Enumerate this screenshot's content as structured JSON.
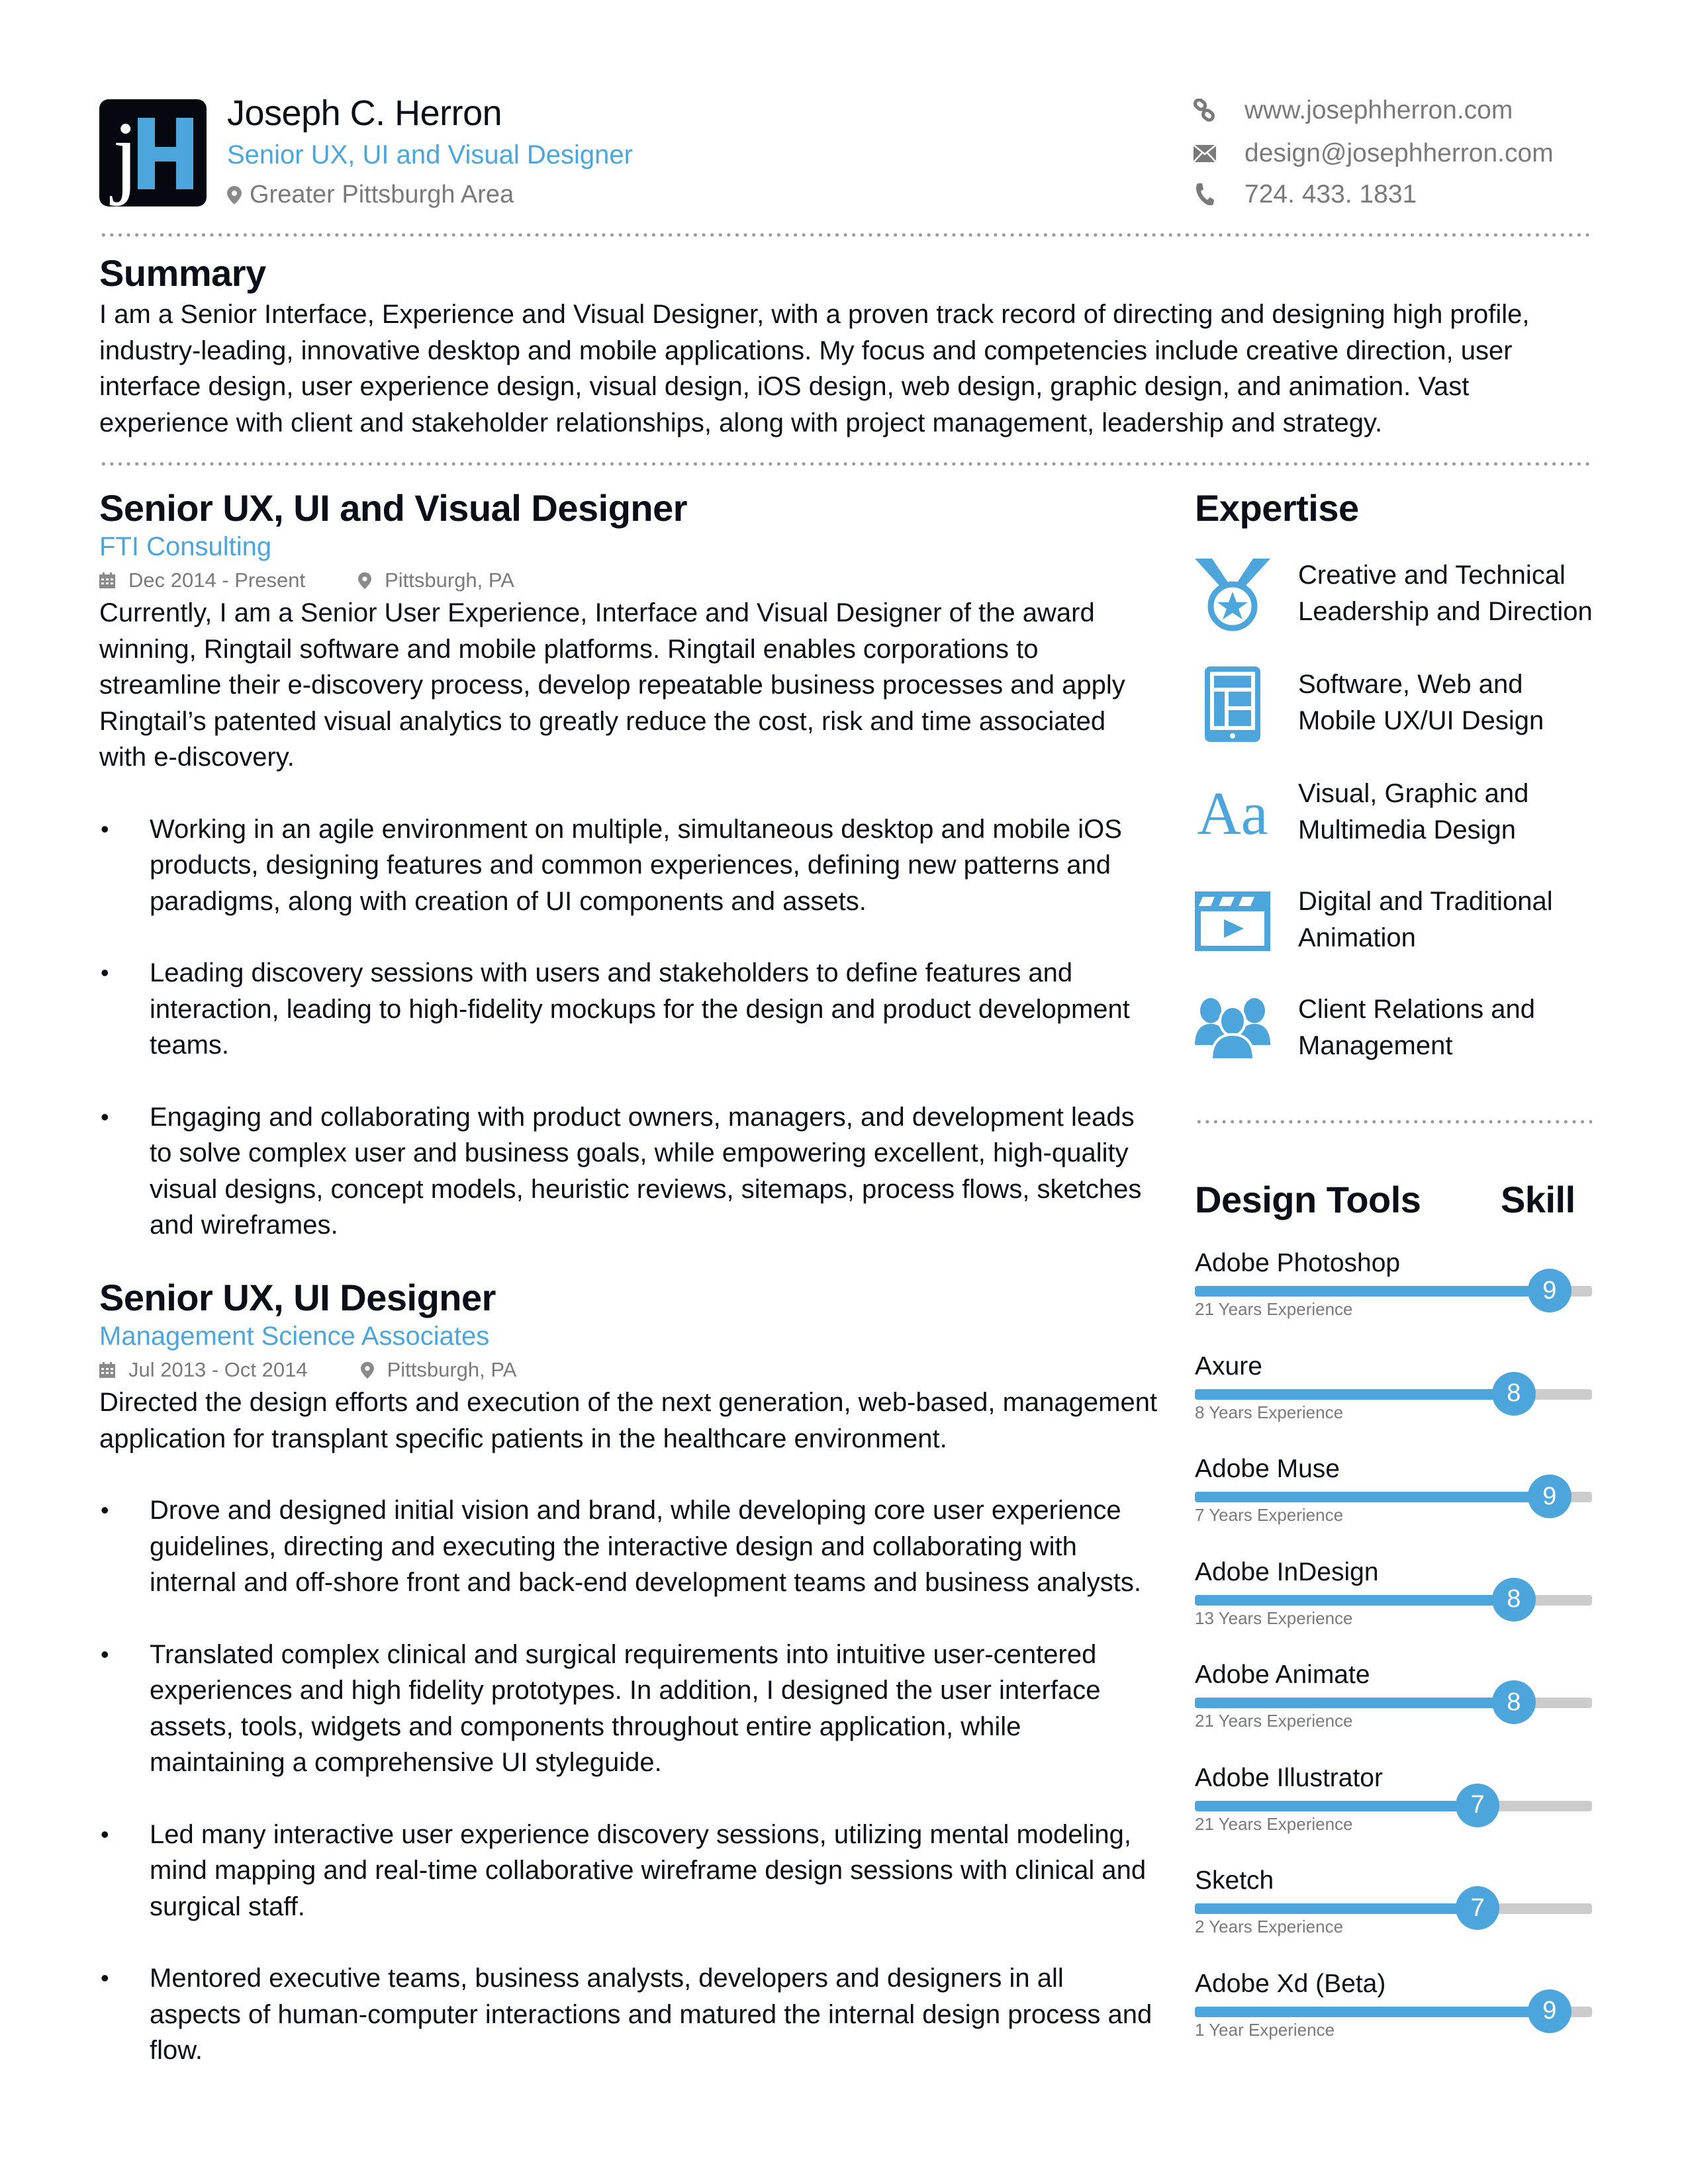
{
  "header": {
    "logo_letters": [
      "j",
      "H"
    ],
    "name": "Joseph C. Herron",
    "title": "Senior UX, UI and Visual Designer",
    "location": "Greater Pittsburgh Area",
    "contacts": [
      {
        "icon": "link-icon",
        "text": "www.josephherron.com"
      },
      {
        "icon": "envelope-icon",
        "text": "design@josephherron.com"
      },
      {
        "icon": "phone-icon",
        "text": "724. 433. 1831"
      }
    ]
  },
  "summary": {
    "heading": "Summary",
    "text": "I am a Senior Interface, Experience and Visual Designer, with a proven track record of directing and designing high profile, industry-leading, innovative desktop and mobile applications.  My focus and competencies include creative direction, user interface design, user experience design, visual design, iOS design, web design, graphic design, and animation.  Vast experience with client and stakeholder relationships, along with project management, leadership and strategy."
  },
  "jobs": [
    {
      "title": "Senior UX, UI and Visual Designer",
      "company": "FTI Consulting",
      "dates": "Dec 2014 - Present",
      "location": "Pittsburgh, PA",
      "description": "Currently, I am a Senior User Experience, Interface and Visual Designer of the award winning, Ringtail software and mobile platforms. Ringtail enables corporations to streamline their e-discovery process, develop repeatable business processes and apply Ringtail’s patented visual analytics to greatly reduce the cost, risk and time associated with e-discovery.",
      "bullets": [
        "Working in an agile environment on multiple, simultaneous desktop and mobile iOS products, designing features and common experiences, defining new patterns and paradigms, along with creation of UI components and assets.",
        "Leading discovery sessions with users and stakeholders to define features and interaction, leading to high-fidelity mockups for the design and product development teams.",
        "Engaging and collaborating with product owners, managers, and development leads to solve complex user and business goals, while empowering excellent, high-quality visual designs, concept models, heuristic reviews, sitemaps, process flows, sketches and wireframes."
      ]
    },
    {
      "title": "Senior UX, UI Designer",
      "company": "Management Science Associates",
      "dates": "Jul 2013 - Oct 2014",
      "location": "Pittsburgh, PA",
      "description": "Directed the design efforts and execution of the next generation, web-based, management application for transplant specific patients in the healthcare environment.",
      "bullets": [
        "Drove and designed initial vision and brand, while developing core user experience guidelines, directing and executing the interactive design and collaborating with internal and off-shore front and back-end development teams and business analysts.",
        "Translated complex clinical and surgical requirements into intuitive user-centered experiences and high fidelity prototypes. In addition, I designed the user interface assets, tools, widgets and components throughout entire application, while maintaining a comprehensive UI styleguide.",
        "Led many interactive user experience discovery sessions, utilizing mental modeling, mind mapping and real-time collaborative wireframe design sessions with clinical and surgical staff.",
        "Mentored executive teams, business analysts, developers and designers in all aspects of human-computer interactions and matured the internal design process and flow."
      ]
    }
  ],
  "expertise": {
    "heading": "Expertise",
    "items": [
      {
        "icon": "medal-icon",
        "label": "Creative and Technical Leadership and Direction"
      },
      {
        "icon": "tablet-icon",
        "label": "Software, Web and Mobile UX/UI Design"
      },
      {
        "icon": "typography-icon",
        "label": "Visual, Graphic and Multimedia Design",
        "glyph": "Aa"
      },
      {
        "icon": "video-clapper-icon",
        "label": "Digital and Traditional Animation"
      },
      {
        "icon": "users-group-icon",
        "label": "Client Relations and Management"
      }
    ]
  },
  "tools": {
    "heading": "Design Tools",
    "skill_heading": "Skill",
    "scale_max": 10,
    "items": [
      {
        "name": "Adobe Photoshop",
        "skill": 9,
        "experience": "21 Years Experience"
      },
      {
        "name": "Axure",
        "skill": 8,
        "experience": "8 Years Experience"
      },
      {
        "name": "Adobe Muse",
        "skill": 9,
        "experience": "7 Years Experience"
      },
      {
        "name": "Adobe InDesign",
        "skill": 8,
        "experience": "13 Years Experience"
      },
      {
        "name": "Adobe Animate",
        "skill": 8,
        "experience": "21 Years Experience"
      },
      {
        "name": "Adobe Illustrator",
        "skill": 7,
        "experience": "21 Years Experience"
      },
      {
        "name": "Sketch",
        "skill": 7,
        "experience": "2 Years Experience"
      },
      {
        "name": "Adobe Xd (Beta)",
        "skill": 9,
        "experience": "1 Year Experience"
      }
    ]
  },
  "colors": {
    "accent": "#4ca6dc",
    "text": "#0b0f17",
    "muted": "#7a7a7a",
    "track": "#cccccc"
  }
}
